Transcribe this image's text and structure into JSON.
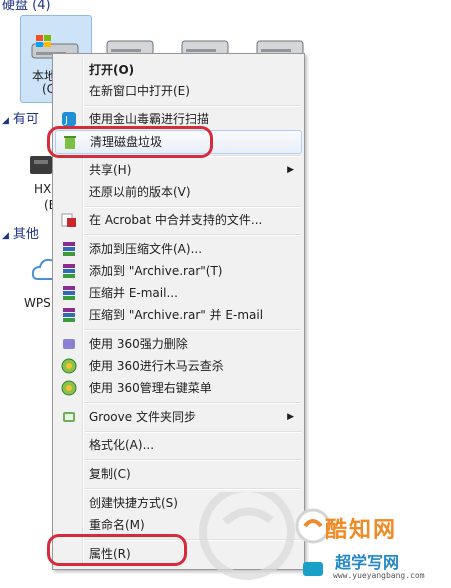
{
  "groups": {
    "disks": "硬盘 (4)",
    "removable": "有可",
    "other": "其他"
  },
  "drives": {
    "local_label_1": "本地",
    "local_label_2": "(C",
    "hx_label_1": "HX0",
    "hx_label_2": "(E",
    "wps_label": "WPS"
  },
  "menu": {
    "open": "打开(O)",
    "open_new_window": "在新窗口中打开(E)",
    "scan_kingsoft": "使用金山毒霸进行扫描",
    "clean_disk": "清理磁盘垃圾",
    "share": "共享(H)",
    "restore": "还原以前的版本(V)",
    "acrobat": "在 Acrobat 中合并支持的文件...",
    "add_archive": "添加到压缩文件(A)...",
    "add_rar": "添加到 \"Archive.rar\"(T)",
    "compress_email": "压缩并 E-mail...",
    "compress_rar_email": "压缩到 \"Archive.rar\" 并 E-mail",
    "del_360": "使用 360强力删除",
    "scan_360": "使用 360进行木马云查杀",
    "manage_360": "使用 360管理右键菜单",
    "groove": "Groove 文件夹同步",
    "format": "格式化(A)...",
    "copy": "复制(C)",
    "shortcut": "创建快捷方式(S)",
    "rename": "重命名(M)",
    "properties": "属性(R)",
    "submenu_arrow": "▶"
  },
  "watermark": {
    "title": "酷知网",
    "site": "超学写网",
    "url": "www.yueyangbang.com"
  },
  "colors": {
    "highlight": "#d62b3a",
    "group_text": "#1e3287",
    "menu_bg": "#f1f1f1"
  }
}
